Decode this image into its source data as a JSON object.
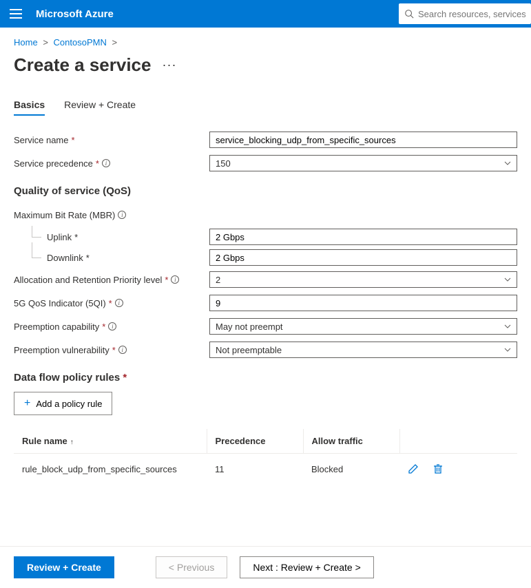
{
  "topbar": {
    "brand": "Microsoft Azure",
    "search_placeholder": "Search resources, services, and"
  },
  "breadcrumb": {
    "items": [
      "Home",
      "ContosoPMN"
    ]
  },
  "page": {
    "title": "Create a service"
  },
  "tabs": [
    {
      "label": "Basics",
      "active": true
    },
    {
      "label": "Review + Create",
      "active": false
    }
  ],
  "form": {
    "service_name": {
      "label": "Service name",
      "value": "service_blocking_udp_from_specific_sources"
    },
    "service_precedence": {
      "label": "Service precedence",
      "value": "150"
    },
    "qos_section": "Quality of service (QoS)",
    "mbr": {
      "label": "Maximum Bit Rate (MBR)"
    },
    "uplink": {
      "label": "Uplink",
      "value": "2 Gbps"
    },
    "downlink": {
      "label": "Downlink",
      "value": "2 Gbps"
    },
    "arp": {
      "label": "Allocation and Retention Priority level",
      "value": "2"
    },
    "fiveqi": {
      "label": "5G QoS Indicator (5QI)",
      "value": "9"
    },
    "preempt_cap": {
      "label": "Preemption capability",
      "value": "May not preempt"
    },
    "preempt_vuln": {
      "label": "Preemption vulnerability",
      "value": "Not preemptable"
    }
  },
  "rules": {
    "section": "Data flow policy rules",
    "add_label": "Add a policy rule",
    "columns": {
      "name": "Rule name",
      "precedence": "Precedence",
      "allow": "Allow traffic"
    },
    "items": [
      {
        "name": "rule_block_udp_from_specific_sources",
        "precedence": "11",
        "allow": "Blocked"
      }
    ]
  },
  "footer": {
    "review": "Review + Create",
    "previous": "< Previous",
    "next": "Next : Review + Create >"
  }
}
